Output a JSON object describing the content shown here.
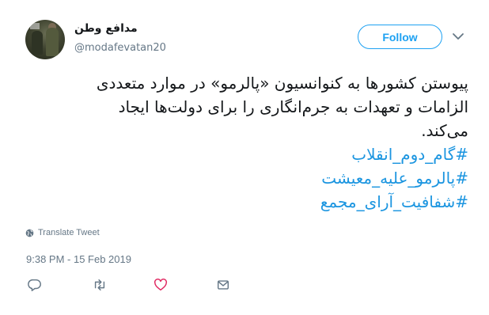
{
  "tweet": {
    "display_name": "مدافع وطن",
    "screen_name": "@modafevatan20",
    "follow_label": "Follow",
    "text_lines": [
      "پیوستن کشورها به کنوانسیون «پالرمو» در موارد متعددی",
      "الزامات و تعهدات به جرم‌انگاری را برای دولت‌ها ایجاد",
      "می‌کند."
    ],
    "hashtags": [
      "#گام_دوم_انقلاب",
      "#پالرمو_علیه_معیشت",
      "#شفافیت_آرای_مجمع"
    ],
    "translate_label": "Translate Tweet",
    "timestamp": "9:38 PM - 15 Feb 2019"
  },
  "icons": {
    "reply": "reply-icon",
    "retweet": "retweet-icon",
    "like": "heart-icon",
    "dm": "mail-icon",
    "menu": "chevron-down-icon",
    "translate": "globe-icon"
  },
  "colors": {
    "accent": "#1da1f2",
    "hashtag": "#1b95e0",
    "secondary_text": "#657786",
    "like": "#e0245e"
  }
}
